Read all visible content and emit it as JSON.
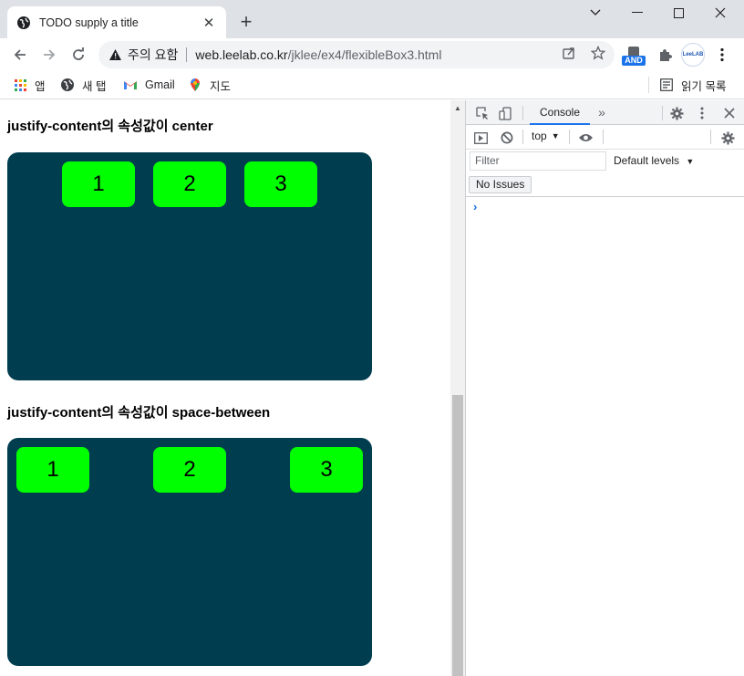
{
  "browser": {
    "tab_title": "TODO supply a title",
    "new_tab_label": "+",
    "window_controls": {
      "minimize": "⌄",
      "restore": "—",
      "maximize": "☐",
      "close": "✕"
    },
    "omnibox": {
      "security_warning": "주의 요함",
      "host": "web.leelab.co.kr",
      "path": "/jklee/ex4/flexibleBox3.html"
    },
    "extensions": {
      "and_label": "AND",
      "leelab_label": "LeeLAB"
    },
    "bookmarks": [
      {
        "label": "앱",
        "icon": "apps-grid-icon"
      },
      {
        "label": "새 탭",
        "icon": "globe-icon"
      },
      {
        "label": "Gmail",
        "icon": "gmail-icon"
      },
      {
        "label": "지도",
        "icon": "maps-pin-icon"
      }
    ],
    "reading_list": "읽기 목록"
  },
  "page": {
    "sections": [
      {
        "heading": "justify-content의 속성값이 center",
        "items": [
          "1",
          "2",
          "3"
        ]
      },
      {
        "heading": "justify-content의 속성값이 space-between",
        "items": [
          "1",
          "2",
          "3"
        ]
      }
    ],
    "colors": {
      "box_bg": "#003d4f",
      "item_bg": "#00ff00"
    }
  },
  "devtools": {
    "active_tab": "Console",
    "context": "top",
    "filter_placeholder": "Filter",
    "levels": "Default levels",
    "issues": "No Issues",
    "prompt": "›"
  }
}
